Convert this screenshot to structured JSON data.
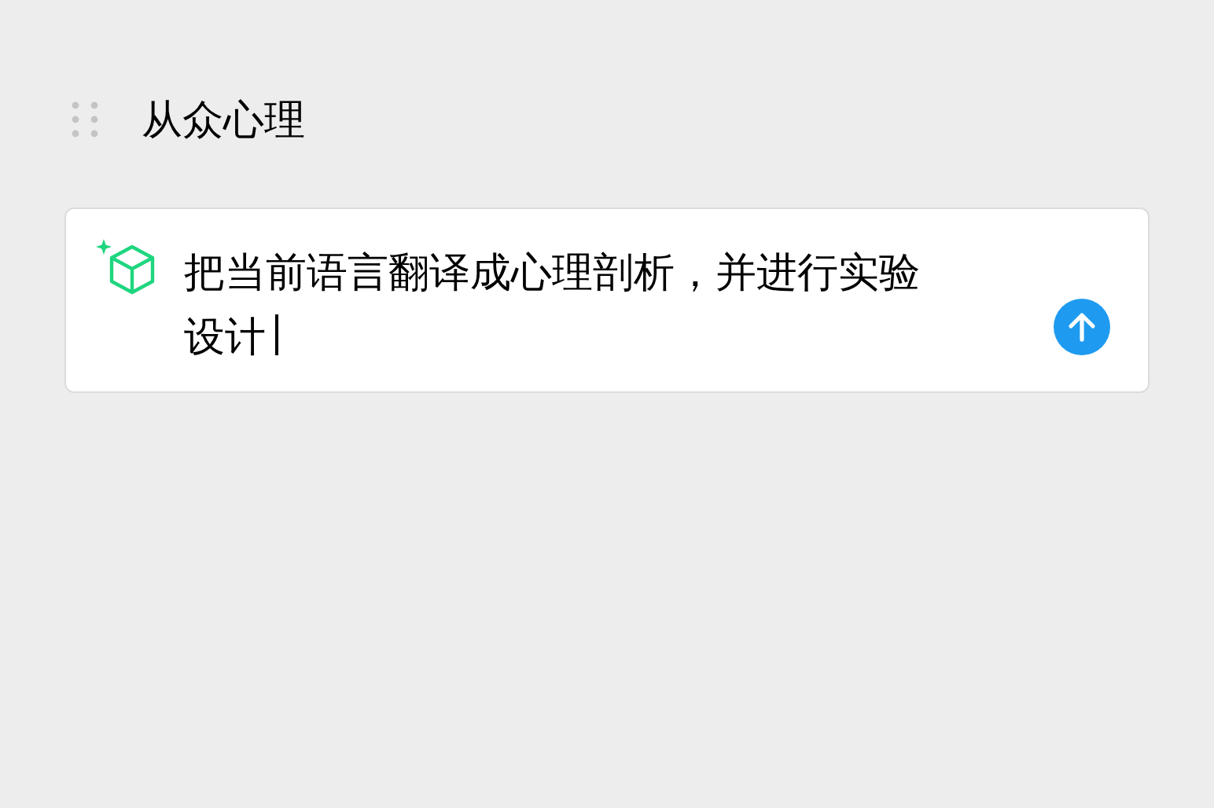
{
  "section": {
    "title": "从众心理"
  },
  "prompt": {
    "value": "把当前语言翻译成心理剖析，并进行实验设计"
  }
}
